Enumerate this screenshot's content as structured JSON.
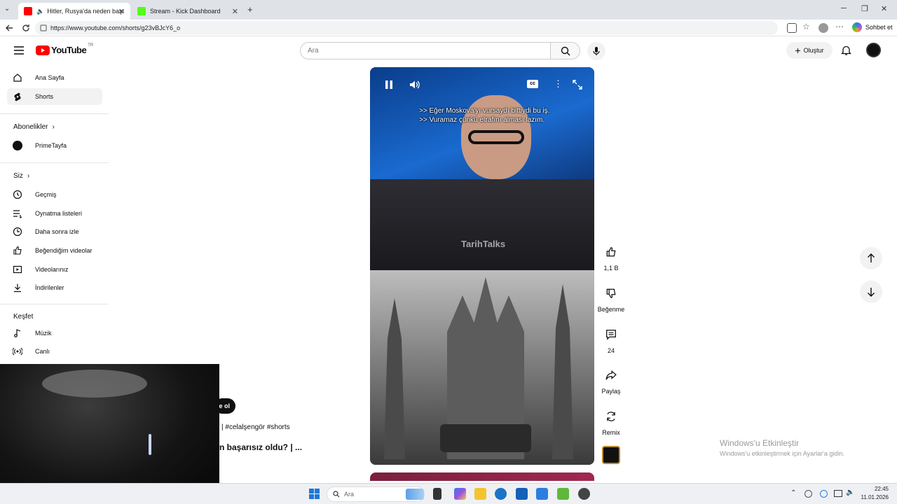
{
  "browser": {
    "tabs": [
      {
        "label": "Hitler, Rusya'da neden başarı..."
      },
      {
        "label": "Stream - Kick Dashboard"
      }
    ],
    "url": "https://www.youtube.com/shorts/g23vBJcY6_o",
    "copilot_label": "Sohbet et"
  },
  "header": {
    "logo_text": "YouTube",
    "logo_country": "TR",
    "search_placeholder": "Ara",
    "create_label": "Oluştur"
  },
  "sidebar": {
    "home": "Ana Sayfa",
    "shorts": "Shorts",
    "subscriptions_title": "Abonelikler",
    "subscription_channel": "PrimeTayfa",
    "you_title": "Siz",
    "you_items": [
      "Geçmiş",
      "Oynatma listeleri",
      "Daha sonra izle",
      "Beğendiğim videolar",
      "Videolarınız",
      "İndirilenler"
    ],
    "explore_title": "Keşfet",
    "explore_items": [
      "Müzik",
      "Canlı"
    ]
  },
  "player": {
    "subtitle_1": ">> Eğer Moskova'yı vursaydı bittiydi bu iş.",
    "subtitle_2": ">> Vuramaz çünkü etrafını alması lazım.",
    "watermark": "TarihTalks"
  },
  "actions": {
    "like_count": "1,1 B",
    "dislike_label": "Beğenme",
    "comment_count": "24",
    "share_label": "Paylaş",
    "remix_label": "Remix"
  },
  "snippets": {
    "badge_text": "e ol",
    "hashtags": "| #celalşengör #shorts",
    "title_fragment": "n başarısız oldu? | ..."
  },
  "windows": {
    "activate_title": "Windows'u Etkinleştir",
    "activate_sub": "Windows'u etkinleştirmek için Ayarlar'a gidin.",
    "taskbar_search": "Ara",
    "time": "22:45",
    "date": "11.01.2026"
  },
  "colors": {
    "youtube_red": "#ff0000",
    "kick_green": "#53fc18"
  }
}
